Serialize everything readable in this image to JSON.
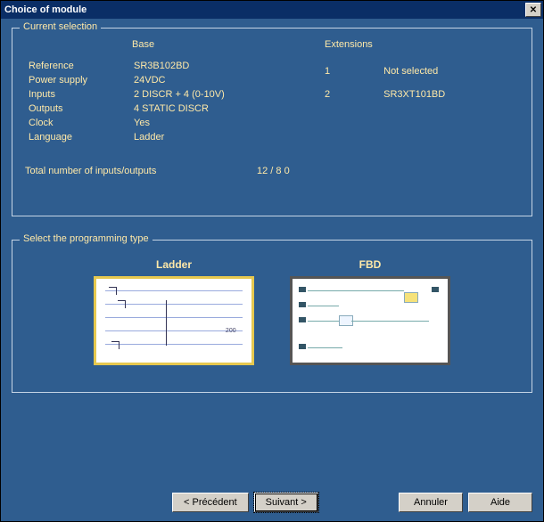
{
  "window": {
    "title": "Choice of module",
    "close_glyph": "✕"
  },
  "current_selection": {
    "legend": "Current selection",
    "base_head": "Base",
    "ext_head": "Extensions",
    "reference_k": "Reference",
    "reference_v": "SR3B102BD",
    "power_k": "Power supply",
    "power_v": "24VDC",
    "inputs_k": "Inputs",
    "inputs_v": "2 DISCR + 4 (0-10V)",
    "outputs_k": "Outputs",
    "outputs_v": "4 STATIC DISCR",
    "clock_k": "Clock",
    "clock_v": "Yes",
    "lang_k": "Language",
    "lang_v": "Ladder",
    "ext1_idx": "1",
    "ext1_val": "Not selected",
    "ext2_idx": "2",
    "ext2_val": "SR3XT101BD",
    "total_k": "Total number of inputs/outputs",
    "total_v": "12 / 8 0"
  },
  "prog": {
    "legend": "Select the programming type",
    "ladder_label": "Ladder",
    "fbd_label": "FBD"
  },
  "buttons": {
    "prev": "< Précédent",
    "next": "Suivant >",
    "cancel": "Annuler",
    "help": "Aide"
  }
}
